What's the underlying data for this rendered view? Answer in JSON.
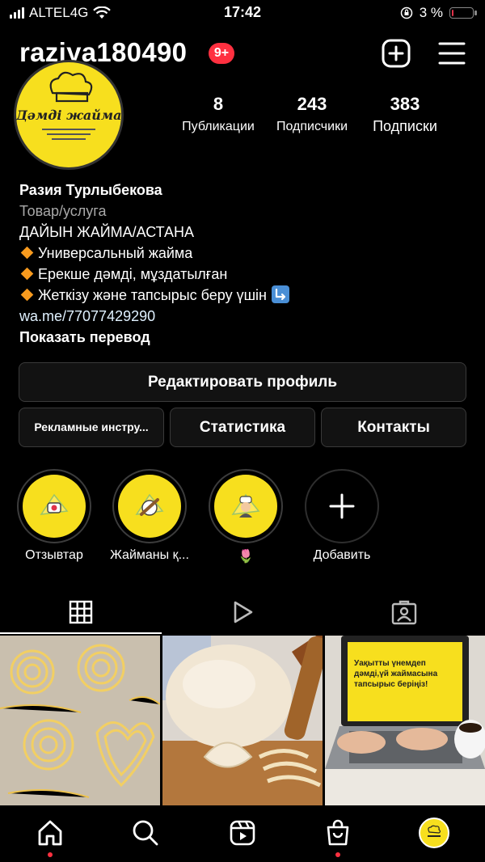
{
  "status_bar": {
    "carrier": "ALTEL4G",
    "time": "17:42",
    "battery_percent": "3 %",
    "icons": [
      "signal-icon",
      "wifi-icon",
      "orientation-lock-icon",
      "battery-icon"
    ]
  },
  "header": {
    "username": "raziya180490",
    "notification_badge": "9+",
    "icons": [
      "new-post-plus-icon",
      "hamburger-menu-icon"
    ]
  },
  "avatar": {
    "logo_text": "Дәмді жайма"
  },
  "stats": [
    {
      "value": "8",
      "label": "Публикации"
    },
    {
      "value": "243",
      "label": "Подписчики"
    },
    {
      "value": "383",
      "label": "Подписки"
    }
  ],
  "bio": {
    "name": "Разия Турлыбекова",
    "category": "Товар/услуга",
    "lines": [
      "ДАЙЫН ЖАЙМА/АСТАНА",
      "Универсальный жайма",
      "Ерекше дәмді, мұздатылған",
      "Жеткізу және тапсырыс беру үшін"
    ],
    "link": "wa.me/77077429290",
    "translate": "Показать перевод"
  },
  "buttons": {
    "edit_profile": "Редактировать профиль",
    "ad_tools": "Рекламные инстру...",
    "insights": "Статистика",
    "contacts": "Контакты"
  },
  "highlights": [
    {
      "label": "Отзывтар",
      "icon": "camera-sticker-icon"
    },
    {
      "label": "Жайманы қ...",
      "icon": "rolling-pin-icon"
    },
    {
      "label": "🌷",
      "icon": "chef-woman-icon"
    },
    {
      "label": "Добавить",
      "icon": "plus-icon"
    }
  ],
  "tabs": [
    {
      "name": "grid",
      "icon": "grid-icon",
      "active": true
    },
    {
      "name": "reels",
      "icon": "reels-play-icon",
      "active": false
    },
    {
      "name": "tagged",
      "icon": "tagged-person-icon",
      "active": false
    }
  ],
  "posts": [
    {
      "subject": "noodle-nests"
    },
    {
      "subject": "dough-and-dumplings"
    },
    {
      "subject": "laptop-order-promo",
      "text": "Уақытты үнемдеп дәмді,үй жаймасына тапсырыс беріңіз!"
    }
  ],
  "bottom_nav": [
    {
      "name": "home",
      "icon": "home-icon",
      "notification_dot": true
    },
    {
      "name": "search",
      "icon": "search-icon"
    },
    {
      "name": "reels",
      "icon": "reels-icon"
    },
    {
      "name": "shop",
      "icon": "shopping-bag-icon",
      "notification_dot": true
    },
    {
      "name": "profile",
      "icon": "profile-avatar-icon"
    }
  ],
  "colors": {
    "background": "#000000",
    "badge_red": "#ff3040",
    "brand_yellow": "#f7df1e",
    "button_bg": "#121212",
    "button_border": "#3a3a3a",
    "muted_text": "#a8a8a8"
  }
}
